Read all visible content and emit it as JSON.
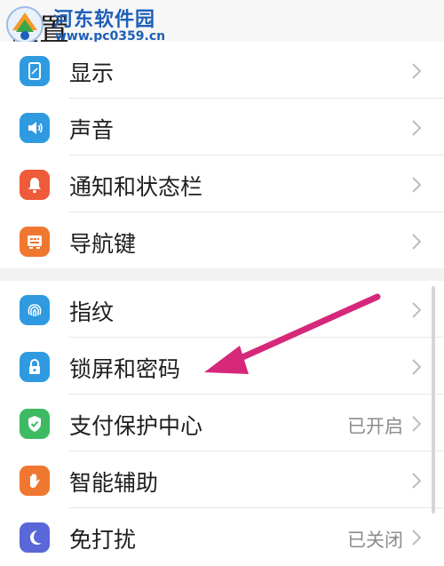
{
  "header": {
    "title": "设置"
  },
  "watermark": {
    "title": "河东软件园",
    "url": "www.pc0359.cn"
  },
  "colors": {
    "display": "#2f9ae0",
    "sound": "#2f9ae0",
    "notifications": "#ef5a3a",
    "navigation": "#f0772f",
    "fingerprint": "#2f9ae0",
    "lockscreen": "#2f9ae0",
    "payment": "#3dba62",
    "assistant": "#f0772f",
    "dnd": "#5a67d8",
    "arrow": "#d6287b"
  },
  "settings": {
    "display": {
      "label": "显示",
      "icon": "phone-screen-icon"
    },
    "sound": {
      "label": "声音",
      "icon": "speaker-icon"
    },
    "notifications": {
      "label": "通知和状态栏",
      "icon": "bell-icon"
    },
    "navigation": {
      "label": "导航键",
      "icon": "navigation-key-icon"
    },
    "fingerprint": {
      "label": "指纹",
      "icon": "fingerprint-icon"
    },
    "lockscreen": {
      "label": "锁屏和密码",
      "icon": "lock-icon"
    },
    "payment": {
      "label": "支付保护中心",
      "value": "已开启",
      "icon": "shield-check-icon"
    },
    "assistant": {
      "label": "智能辅助",
      "icon": "hand-icon"
    },
    "dnd": {
      "label": "免打扰",
      "value": "已关闭",
      "icon": "moon-icon"
    }
  }
}
